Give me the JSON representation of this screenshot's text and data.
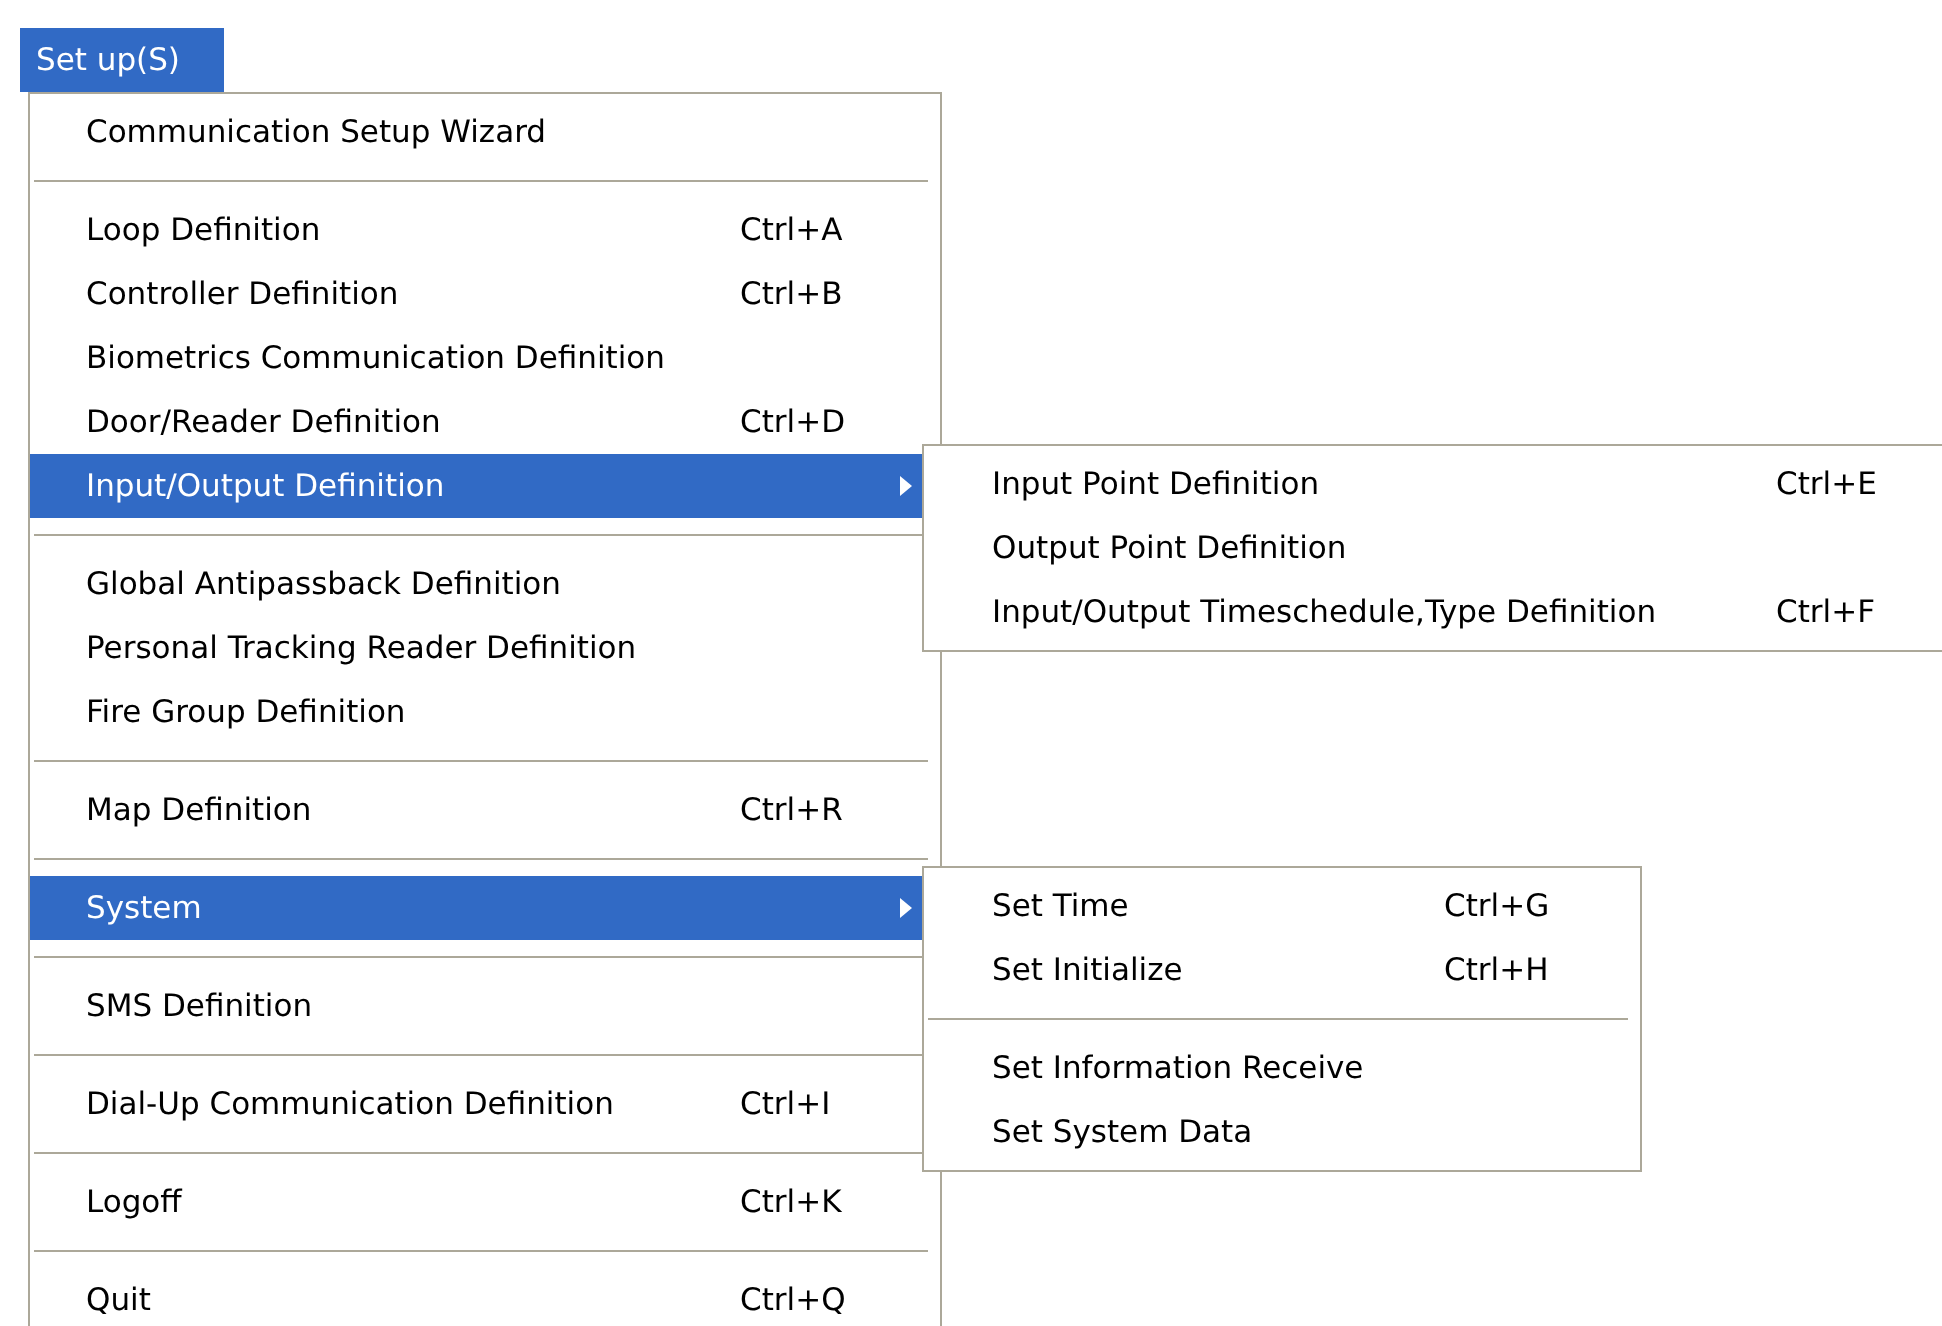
{
  "menubar": {
    "title": "Set up(S)",
    "selected": true
  },
  "menu": {
    "items": [
      {
        "kind": "item",
        "label": "Communication Setup Wizard",
        "selected": false
      },
      {
        "kind": "separator"
      },
      {
        "kind": "item",
        "label": "Loop Definition",
        "shortcut": "Ctrl+A",
        "selected": false
      },
      {
        "kind": "item",
        "label": "Controller Definition",
        "shortcut": "Ctrl+B",
        "selected": false
      },
      {
        "kind": "item",
        "label": "Biometrics Communication Definition",
        "selected": false
      },
      {
        "kind": "item",
        "label": "Door/Reader Definition",
        "shortcut": "Ctrl+D",
        "selected": false
      },
      {
        "kind": "item",
        "label": "Input/Output Definition",
        "selected": true,
        "submenu": {
          "items": [
            {
              "kind": "item",
              "label": "Input Point Definition",
              "shortcut": "Ctrl+E",
              "selected": false
            },
            {
              "kind": "item",
              "label": "Output Point Definition",
              "selected": false
            },
            {
              "kind": "item",
              "label": "Input/Output Timeschedule,Type Definition",
              "shortcut": "Ctrl+F",
              "selected": false
            }
          ]
        }
      },
      {
        "kind": "separator"
      },
      {
        "kind": "item",
        "label": "Global Antipassback Definition",
        "selected": false
      },
      {
        "kind": "item",
        "label": "Personal Tracking Reader Definition",
        "selected": false
      },
      {
        "kind": "item",
        "label": "Fire Group Definition",
        "selected": false
      },
      {
        "kind": "separator"
      },
      {
        "kind": "item",
        "label": "Map Definition",
        "shortcut": "Ctrl+R",
        "selected": false
      },
      {
        "kind": "separator"
      },
      {
        "kind": "item",
        "label": "System",
        "selected": true,
        "submenu": {
          "items": [
            {
              "kind": "item",
              "label": "Set Time",
              "shortcut": "Ctrl+G",
              "selected": false
            },
            {
              "kind": "item",
              "label": "Set Initialize",
              "shortcut": "Ctrl+H",
              "selected": false
            },
            {
              "kind": "separator"
            },
            {
              "kind": "item",
              "label": "Set Information Receive",
              "selected": false
            },
            {
              "kind": "item",
              "label": "Set System Data",
              "selected": false
            }
          ]
        }
      },
      {
        "kind": "separator"
      },
      {
        "kind": "item",
        "label": "SMS Definition",
        "selected": false
      },
      {
        "kind": "separator"
      },
      {
        "kind": "item",
        "label": "Dial-Up Communication Definition",
        "shortcut": "Ctrl+I",
        "selected": false
      },
      {
        "kind": "separator"
      },
      {
        "kind": "item",
        "label": "Logoff",
        "shortcut": "Ctrl+K",
        "selected": false
      },
      {
        "kind": "separator"
      },
      {
        "kind": "item",
        "label": "Quit",
        "shortcut": "Ctrl+Q",
        "selected": false
      }
    ]
  }
}
